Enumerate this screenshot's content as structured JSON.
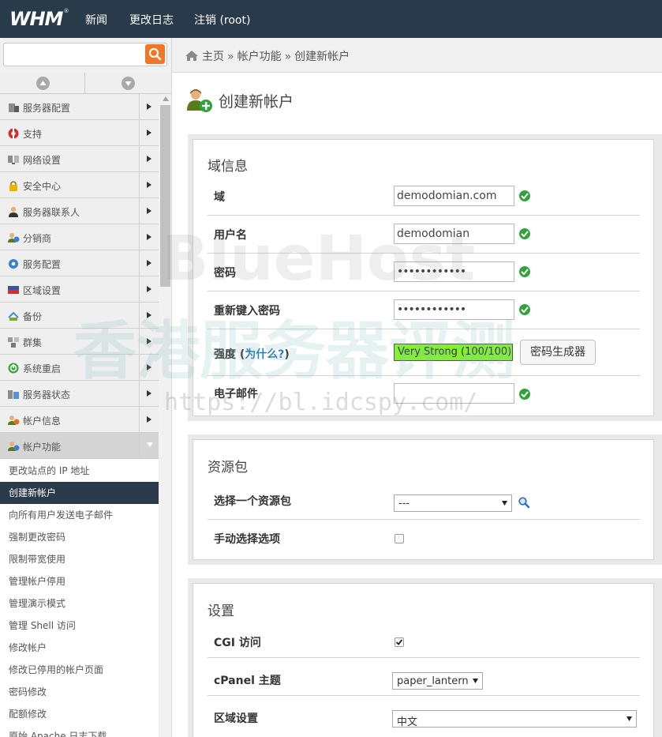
{
  "app": {
    "logo_text": "WHM",
    "logo_reg": "®",
    "nav": [
      "新闻",
      "更改日志",
      "注销 (root)"
    ]
  },
  "search": {
    "value": "",
    "placeholder": ""
  },
  "breadcrumb": {
    "items": [
      "主页",
      "帐户功能",
      "创建新帐户"
    ],
    "separator": "»"
  },
  "sidebar": {
    "categories": [
      {
        "label": "服务器配置",
        "icon": "server-config-icon"
      },
      {
        "label": "支持",
        "icon": "support-icon"
      },
      {
        "label": "网络设置",
        "icon": "network-icon"
      },
      {
        "label": "安全中心",
        "icon": "lock-icon"
      },
      {
        "label": "服务器联系人",
        "icon": "contact-icon"
      },
      {
        "label": "分销商",
        "icon": "reseller-icon"
      },
      {
        "label": "服务配置",
        "icon": "gear-icon"
      },
      {
        "label": "区域设置",
        "icon": "locale-icon"
      },
      {
        "label": "备份",
        "icon": "backup-icon"
      },
      {
        "label": "群集",
        "icon": "cluster-icon"
      },
      {
        "label": "系统重启",
        "icon": "power-icon"
      },
      {
        "label": "服务器状态",
        "icon": "status-icon"
      },
      {
        "label": "帐户信息",
        "icon": "account-info-icon"
      },
      {
        "label": "帐户功能",
        "icon": "account-functions-icon",
        "expanded": true
      }
    ],
    "sub_items": [
      "更改站点的 IP 地址",
      "创建新帐户",
      "向所有用户发送电子邮件",
      "强制更改密码",
      "限制带宽使用",
      "管理帐户停用",
      "管理演示模式",
      "管理 Shell 访问",
      "修改帐户",
      "修改已停用的帐户页面",
      "密码修改",
      "配额修改",
      "原始 Apache 日志下载"
    ],
    "active_sub": 1
  },
  "page": {
    "title": "创建新帐户",
    "domain_info": {
      "title": "域信息",
      "domain_label": "域",
      "domain_value": "demodomian.com",
      "username_label": "用户名",
      "username_value": "demodomian",
      "password_label": "密码",
      "password_value": "••••••••••••",
      "retype_label": "重新键入密码",
      "retype_value": "••••••••••••",
      "strength_label": "强度",
      "strength_paren_open": " (",
      "strength_link": "为什么?",
      "strength_paren_close": ")",
      "strength_value": "Very Strong (100/100)",
      "generator_button": "密码生成器",
      "email_label": "电子邮件",
      "email_value": ""
    },
    "package": {
      "title": "资源包",
      "choose_label": "选择一个资源包",
      "choose_value": "---",
      "manual_label": "手动选择选项",
      "manual_checked": false
    },
    "settings": {
      "title": "设置",
      "cgi_label": "CGI 访问",
      "cgi_checked": true,
      "theme_label": "cPanel 主题",
      "theme_value": "paper_lantern",
      "locale_label": "区域设置",
      "locale_value": "中文"
    }
  },
  "watermark": {
    "brand": "BlueHost",
    "cn": "香港服务器评测",
    "url": "https://bl.idcspy.com/"
  },
  "colors": {
    "topbar": "#293a4a",
    "search_button": "#f27526",
    "valid": "#2fa43a",
    "strength": "#85f033",
    "link": "#2a7db8"
  }
}
